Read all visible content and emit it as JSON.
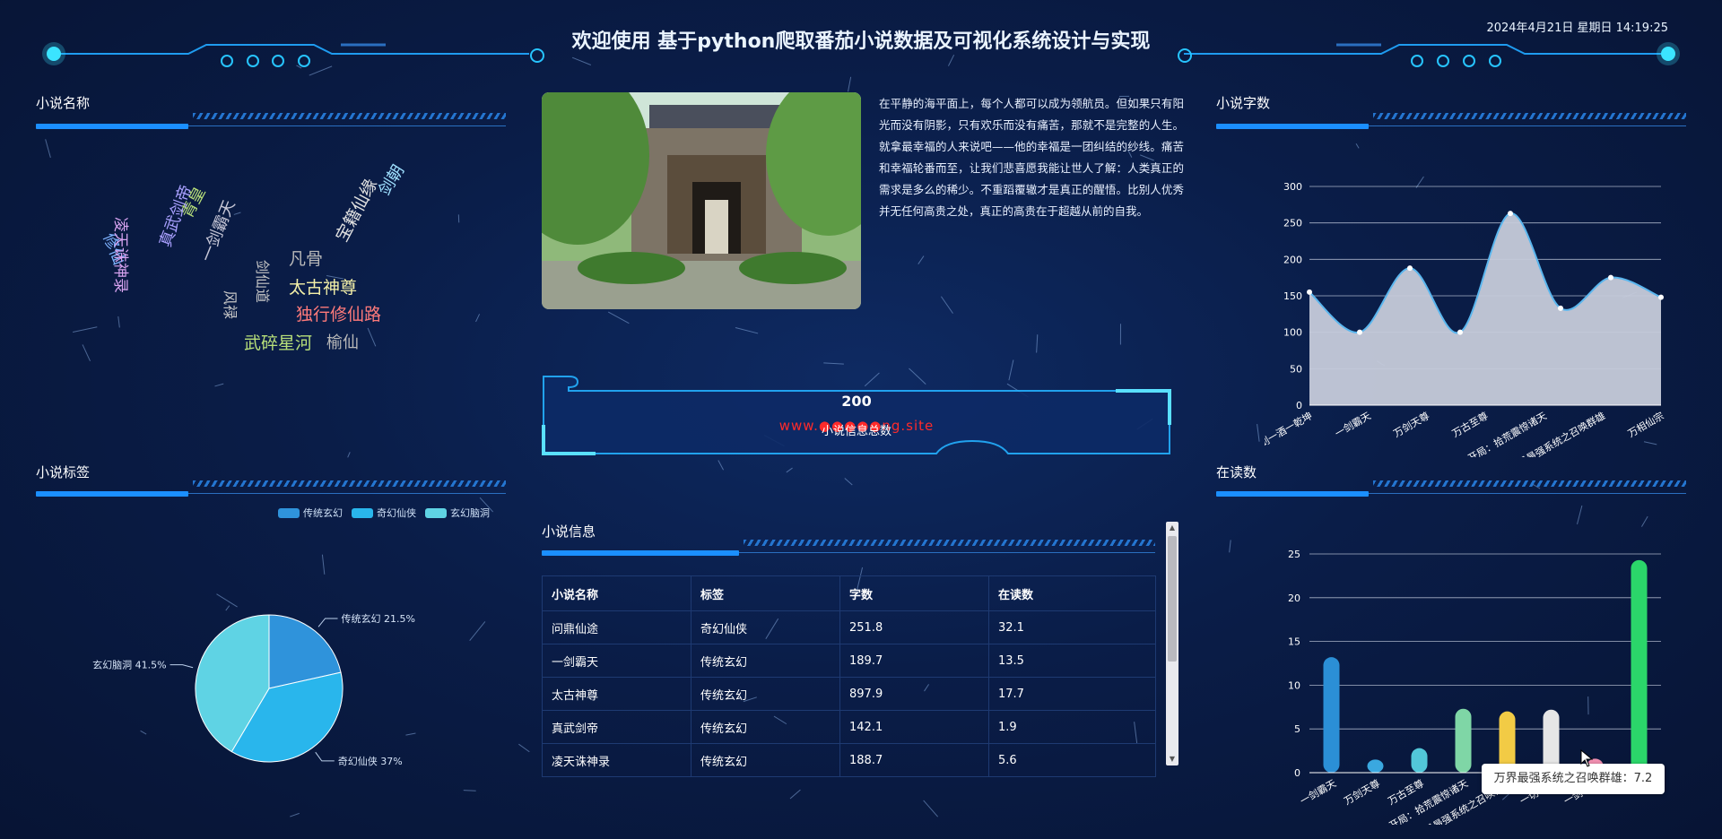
{
  "header": {
    "title": "欢迎使用 基于python爬取番茄小说数据及可视化系统设计与实现",
    "datetime": "2024年4月21日 星期日 14:19:25"
  },
  "panels": {
    "novel_names": "小说名称",
    "novel_tags": "小说标签",
    "novel_words": "小说字数",
    "reading": "在读数",
    "novel_info": "小说信息"
  },
  "wordcloud": [
    {
      "text": "修仙",
      "color": "#7fb3ff"
    },
    {
      "text": "凌天诛神录",
      "color": "#d7a3f0"
    },
    {
      "text": "青皇",
      "color": "#b8e07a"
    },
    {
      "text": "真武剑帝",
      "color": "#a9a0ff"
    },
    {
      "text": "一剑霸天",
      "color": "#c8c8d8"
    },
    {
      "text": "风禄",
      "color": "#c7c7c7"
    },
    {
      "text": "剑仙道",
      "color": "#c7c7c7"
    },
    {
      "text": "凡骨",
      "color": "#b9b9b9"
    },
    {
      "text": "太古神尊",
      "color": "#f4f0a8"
    },
    {
      "text": "独行修仙路",
      "color": "#ff7a7a"
    },
    {
      "text": "武碎星河",
      "color": "#b8e07a"
    },
    {
      "text": "榆仙",
      "color": "#b9b9b9"
    },
    {
      "text": "宝籍仙缘",
      "color": "#e0e0e0"
    },
    {
      "text": "剑朝",
      "color": "#9fe0ff"
    }
  ],
  "intro": "在平静的海平面上，每个人都可以成为领航员。但如果只有阳光而没有阴影，只有欢乐而没有痛苦，那就不是完整的人生。就拿最幸福的人来说吧——他的幸福是一团纠结的纱线。痛苦和幸福轮番而至，让我们悲喜愿我能让世人了解：人类真正的需求是多么的稀少。不重蹈覆辙才是真正的醒悟。比别人优秀并无任何高贵之处，真正的高贵在于超越从前的自我。",
  "count": {
    "value": "200",
    "label": "小说信息总数"
  },
  "watermark": "www.●●●●●ng.site",
  "table": {
    "headers": [
      "小说名称",
      "标签",
      "字数",
      "在读数"
    ],
    "rows": [
      [
        "问鼎仙途",
        "奇幻仙侠",
        "251.8",
        "32.1"
      ],
      [
        "一剑霸天",
        "传统玄幻",
        "189.7",
        "13.5"
      ],
      [
        "太古神尊",
        "传统玄幻",
        "897.9",
        "17.7"
      ],
      [
        "真武剑帝",
        "传统玄幻",
        "142.1",
        "1.9"
      ],
      [
        "凌天诛神录",
        "传统玄幻",
        "188.7",
        "5.6"
      ]
    ]
  },
  "tooltip": "万界最强系统之召唤群雄：7.2",
  "colors": {
    "accent": "#1b8fff",
    "background": "#0a1d48"
  },
  "chart_data": [
    {
      "type": "pie",
      "legend_position": "top-right",
      "labels": [
        "传统玄幻",
        "奇幻仙侠",
        "玄幻脑洞"
      ],
      "values": [
        21.5,
        37,
        41.5
      ],
      "label_texts": [
        "传统玄幻 21.5%",
        "奇幻仙侠 37%",
        "玄幻脑洞 41.5%"
      ],
      "colors": [
        "#2f93db",
        "#29b6ec",
        "#5fd3e4"
      ]
    },
    {
      "type": "area",
      "categories": [
        "一剑一酒一乾坤",
        "一剑霸天",
        "万剑天尊",
        "万古至尊",
        "万古至尊",
        "开局：拾荒震惊诸天",
        "万界最强系统之召唤群雄",
        "万相仙宗"
      ],
      "tick_labels": [
        "一剑一酒一乾坤",
        "一剑霸天",
        "万剑天尊",
        "万古至尊",
        "开局：拾荒震惊诸天",
        "万界最强系统之召唤群雄",
        "万相仙宗"
      ],
      "values": [
        155,
        100,
        188,
        100,
        263,
        133,
        175,
        148
      ],
      "ylim": [
        0,
        300
      ],
      "yticks": [
        0,
        50,
        100,
        150,
        200,
        250,
        300
      ],
      "grid": true,
      "fill": "#c6cbda",
      "line": "#5ab6ee"
    },
    {
      "type": "bar",
      "categories": [
        "一剑霸天",
        "万剑天尊",
        "万古至尊",
        "开局：拾荒震惊诸天",
        "万界最强系统之召唤群雄",
        "一切尽在",
        "一剑一酒"
      ],
      "tick_labels": [
        "一剑霸天",
        "万剑天尊",
        "万古至尊",
        "开局：拾荒震惊诸天",
        "万界最强系统之召唤群雄",
        "一切尽在",
        "一剑一酒"
      ],
      "values": [
        13.2,
        1.5,
        2.8,
        7.3,
        7.0,
        7.2,
        1.6,
        24.3
      ],
      "colors": [
        "#2b8fd6",
        "#3aa8e0",
        "#52c7d8",
        "#7fd6a6",
        "#f2cb45",
        "#e6e6e6",
        "#f08fb0",
        "#2bd66a"
      ],
      "ylim": [
        0,
        25
      ],
      "yticks": [
        0,
        5,
        10,
        15,
        20,
        25
      ],
      "grid": true
    }
  ]
}
